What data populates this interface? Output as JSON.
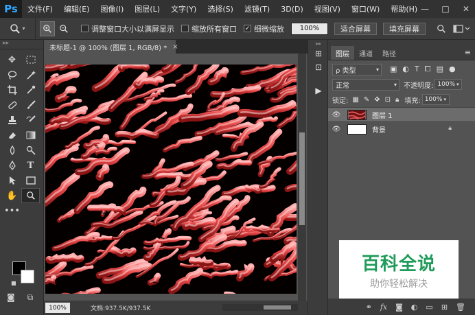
{
  "app": {
    "logo": "Ps",
    "menu": [
      "文件(F)",
      "编辑(E)",
      "图像(I)",
      "图层(L)",
      "文字(Y)",
      "选择(S)",
      "滤镜(T)",
      "3D(D)",
      "视图(V)",
      "窗口(W)",
      "帮助(H)"
    ],
    "window_controls": [
      "—",
      "□",
      "✕"
    ]
  },
  "options": {
    "tool_icon": "zoom-icon",
    "zoom_in": "+",
    "zoom_out": "−",
    "resize_windows": "调整窗口大小以满屏显示",
    "resize_windows_checked": false,
    "zoom_all": "缩放所有窗口",
    "zoom_all_checked": false,
    "scrubby": "细微缩放",
    "scrubby_checked": true,
    "zoom_value": "100%",
    "fit_screen": "适合屏幕",
    "fill_screen": "填充屏幕"
  },
  "document": {
    "tab_title": "未标题-1 @ 100% (图层 1, RGB/8) *",
    "close": "×",
    "zoom": "100%",
    "doc_info": "文档:937.5K/937.5K"
  },
  "layers_panel": {
    "tabs": [
      "图层",
      "通道",
      "路径"
    ],
    "active_tab": 0,
    "filter_label": "ρ 类型",
    "blend_mode": "正常",
    "opacity_label": "不透明度:",
    "opacity_value": "100%",
    "lock_label": "锁定:",
    "fill_label": "填充:",
    "fill_value": "100%",
    "layers": [
      {
        "name": "图层 1",
        "visible": true,
        "selected": true,
        "locked": false
      },
      {
        "name": "背景",
        "visible": true,
        "selected": false,
        "locked": true
      }
    ]
  },
  "watermark": {
    "title": "百科全说",
    "subtitle": "助你轻松解决"
  },
  "colors": {
    "foreground": "#000000",
    "background": "#ffffff",
    "pattern_red": "#e84a4a",
    "pattern_dark": "#050000"
  }
}
